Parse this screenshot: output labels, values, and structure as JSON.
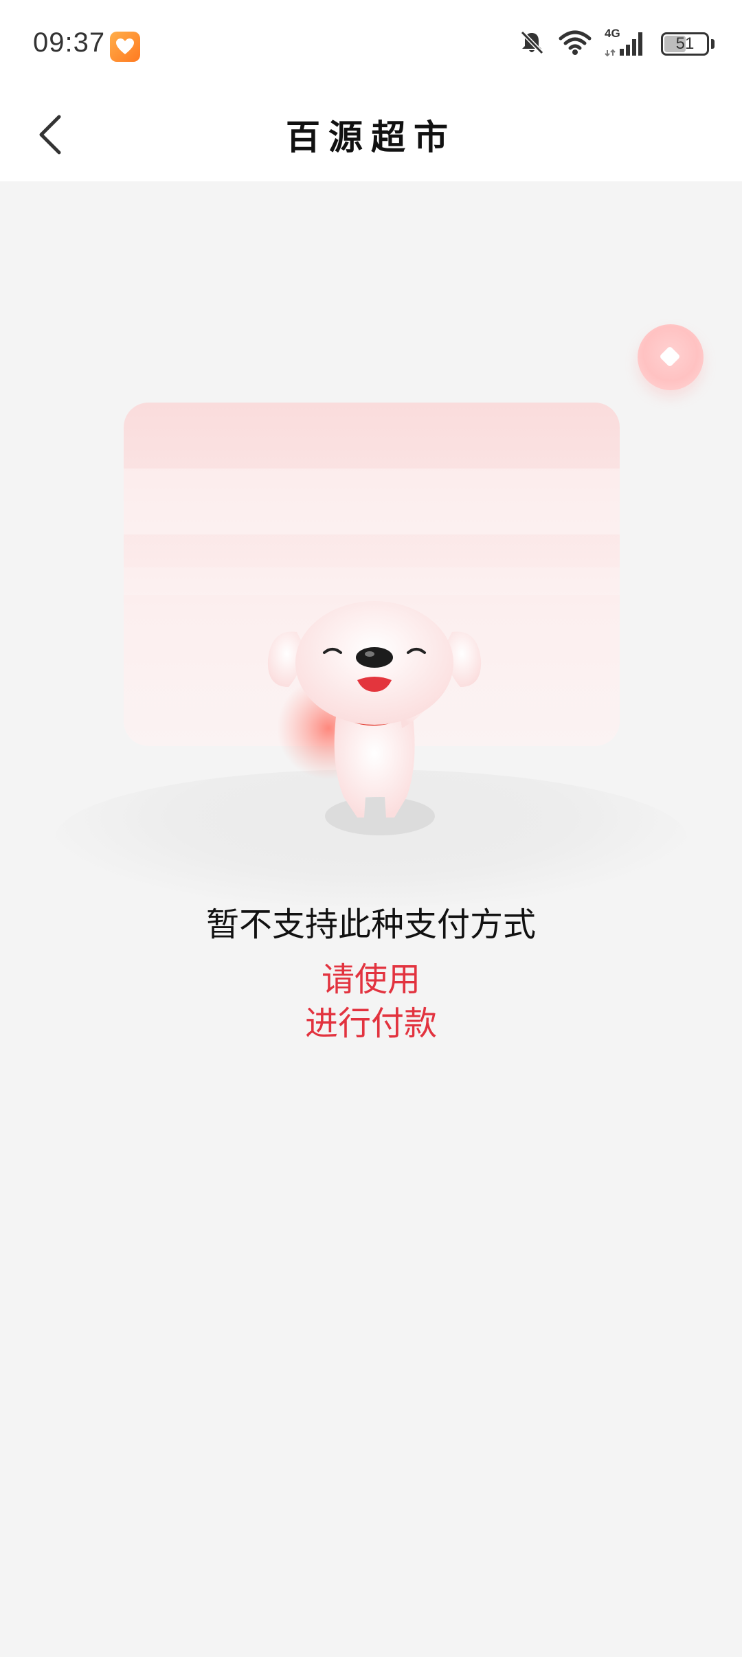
{
  "status_bar": {
    "time": "09:37",
    "network": "4G",
    "battery_level": "51",
    "battery_fraction": 0.51,
    "icons": [
      "app-notification-icon",
      "bell-muted-icon",
      "wifi-icon",
      "signal-icon",
      "battery-icon"
    ]
  },
  "nav": {
    "title": "百源超市",
    "back_icon": "chevron-left-icon"
  },
  "float_button": {
    "icon": "diamond-icon"
  },
  "content": {
    "message": "暂不支持此种支付方式",
    "hint_line1": "请使用",
    "hint_line2": "进行付款"
  },
  "colors": {
    "accent": "#e2333f",
    "background": "#f4f4f4",
    "text": "#111111"
  }
}
